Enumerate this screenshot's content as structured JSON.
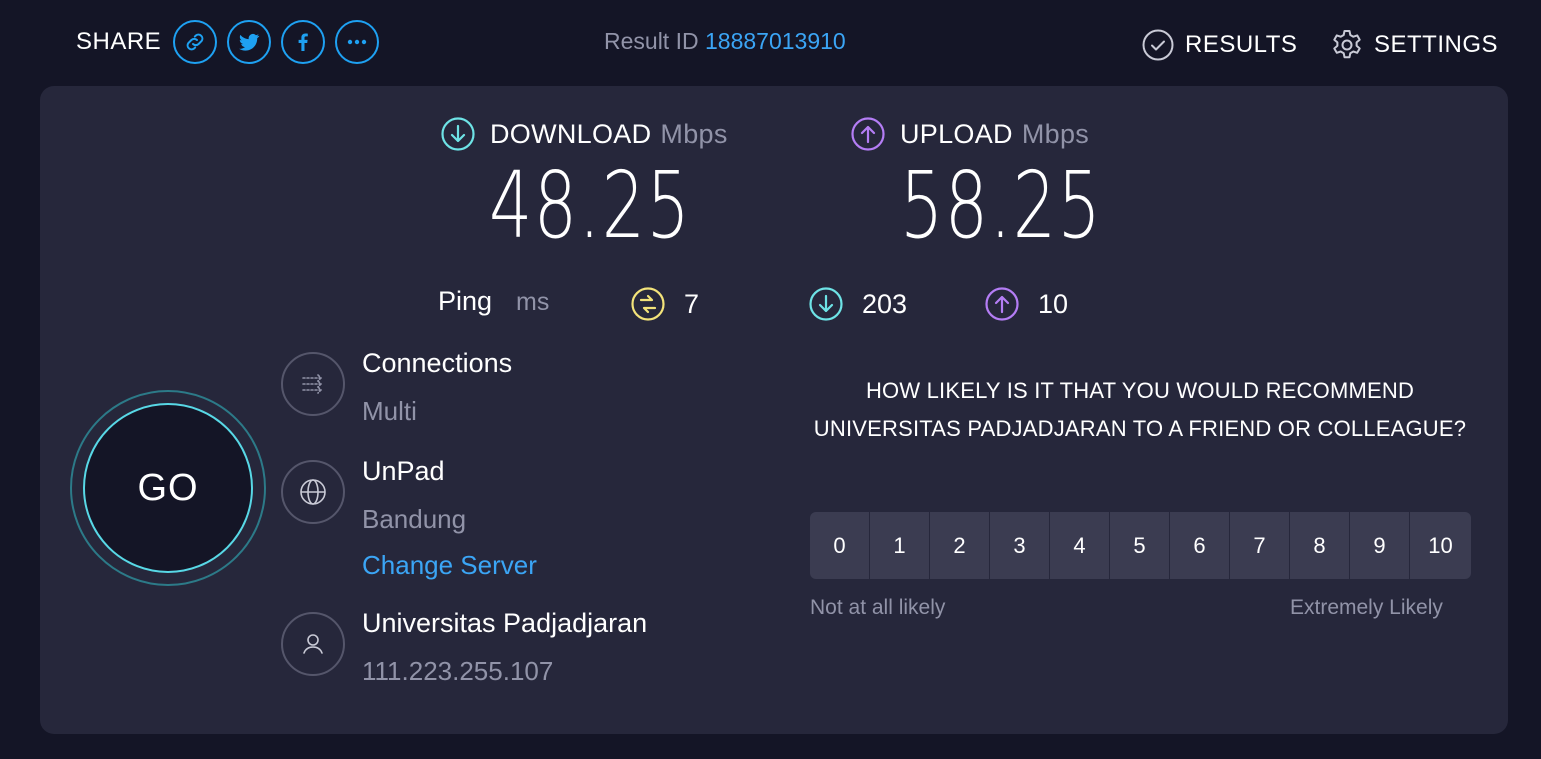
{
  "header": {
    "share_label": "SHARE",
    "share_buttons": [
      {
        "icon": "link-icon"
      },
      {
        "icon": "twitter-icon"
      },
      {
        "icon": "facebook-icon"
      },
      {
        "icon": "more-icon"
      }
    ],
    "result_id_label": "Result ID",
    "result_id": "18887013910",
    "results_label": "RESULTS",
    "settings_label": "SETTINGS"
  },
  "download": {
    "label": "DOWNLOAD",
    "unit": "Mbps",
    "value": "48.25",
    "color": "#6ee3e6"
  },
  "upload": {
    "label": "UPLOAD",
    "unit": "Mbps",
    "value": "58.25",
    "color": "#b47df5"
  },
  "ping": {
    "label": "Ping",
    "unit": "ms",
    "jitter": "7",
    "download": "203",
    "upload": "10",
    "jitter_color": "#f3e37a"
  },
  "go_label": "GO",
  "connections": {
    "title": "Connections",
    "value": "Multi"
  },
  "server": {
    "title": "UnPad",
    "location": "Bandung",
    "change_link": "Change Server"
  },
  "isp": {
    "title": "Universitas Padjadjaran",
    "ip": "111.223.255.107"
  },
  "survey": {
    "question": "HOW LIKELY IS IT THAT YOU WOULD RECOMMEND UNIVERSITAS PADJADJARAN TO A FRIEND OR COLLEAGUE?",
    "scale": [
      "0",
      "1",
      "2",
      "3",
      "4",
      "5",
      "6",
      "7",
      "8",
      "9",
      "10"
    ],
    "low_label": "Not at all likely",
    "high_label": "Extremely Likely"
  },
  "colors": {
    "accent": "#1ea1f2",
    "background": "#141526",
    "panel": "#26273b"
  }
}
